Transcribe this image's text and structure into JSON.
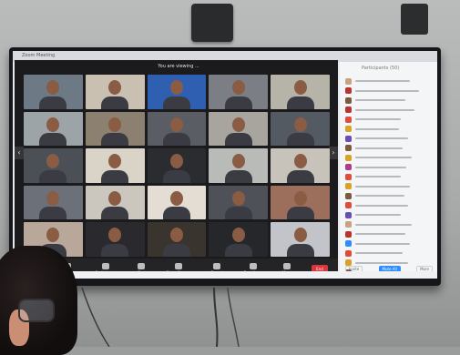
{
  "window": {
    "title": "Zoom Meeting"
  },
  "banner": "You are viewing ...",
  "nav": {
    "prev_icon": "chevron-left-icon",
    "next_icon": "chevron-right-icon"
  },
  "tiles": [
    {
      "name": "",
      "bg": "#6d7a86"
    },
    {
      "name": "",
      "bg": "#c9c0b2"
    },
    {
      "name": "",
      "bg": "#2f5fb0"
    },
    {
      "name": "",
      "bg": "#7b7f85"
    },
    {
      "name": "",
      "bg": "#b6b3a8"
    },
    {
      "name": "",
      "bg": "#9da4a8"
    },
    {
      "name": "",
      "bg": "#8c8170"
    },
    {
      "name": "",
      "bg": "#5a5d63"
    },
    {
      "name": "",
      "bg": "#a7a59d"
    },
    {
      "name": "",
      "bg": "#545a62"
    },
    {
      "name": "",
      "bg": "#4b4f56"
    },
    {
      "name": "",
      "bg": "#d9d3c8"
    },
    {
      "name": "",
      "bg": "#2b2c30"
    },
    {
      "name": "",
      "bg": "#b9bbb8"
    },
    {
      "name": "",
      "bg": "#c7c3bb"
    },
    {
      "name": "",
      "bg": "#6c7078"
    },
    {
      "name": "",
      "bg": "#cbc6be"
    },
    {
      "name": "",
      "bg": "#e3ddd4"
    },
    {
      "name": "",
      "bg": "#4e5158"
    },
    {
      "name": "",
      "bg": "#9b6f5c"
    },
    {
      "name": "",
      "bg": "#b9a89a"
    },
    {
      "name": "",
      "bg": "#2a2a2e"
    },
    {
      "name": "",
      "bg": "#3a342f"
    },
    {
      "name": "",
      "bg": "#26272a"
    },
    {
      "name": "",
      "bg": "#c2c4c9"
    }
  ],
  "toolbar": {
    "items": [
      {
        "label": "Unmute",
        "icon": "microphone-icon"
      },
      {
        "label": "Security",
        "icon": "shield-icon"
      },
      {
        "label": "Participants",
        "icon": "participants-icon"
      },
      {
        "label": "Chat",
        "icon": "chat-icon"
      },
      {
        "label": "Share Screen",
        "icon": "share-screen-icon"
      },
      {
        "label": "Record",
        "icon": "record-icon"
      },
      {
        "label": "Reactions",
        "icon": "reactions-icon"
      },
      {
        "label": "More",
        "icon": "more-icon"
      }
    ],
    "end_label": "End"
  },
  "participants_panel": {
    "header": "Participants (50)",
    "rows": [
      {
        "color": "#c9a27e",
        "w": 60
      },
      {
        "color": "#b8342f",
        "w": 70
      },
      {
        "color": "#7c5a3f",
        "w": 55
      },
      {
        "color": "#b8342f",
        "w": 65
      },
      {
        "color": "#e14b3b",
        "w": 50
      },
      {
        "color": "#d9a227",
        "w": 48
      },
      {
        "color": "#6a4fb3",
        "w": 58
      },
      {
        "color": "#7c5a3f",
        "w": 52
      },
      {
        "color": "#d9a227",
        "w": 62
      },
      {
        "color": "#b23a8b",
        "w": 56
      },
      {
        "color": "#e14b3b",
        "w": 50
      },
      {
        "color": "#d9a227",
        "w": 60
      },
      {
        "color": "#7c5a3f",
        "w": 54
      },
      {
        "color": "#e14b3b",
        "w": 58
      },
      {
        "color": "#6a4fb3",
        "w": 50
      },
      {
        "color": "#c9a27e",
        "w": 62
      },
      {
        "color": "#b8342f",
        "w": 55
      },
      {
        "color": "#2d8cff",
        "w": 60
      },
      {
        "color": "#e14b3b",
        "w": 52
      },
      {
        "color": "#d9a227",
        "w": 58
      },
      {
        "color": "#7c5a3f",
        "w": 50
      }
    ],
    "invite_label": "Invite",
    "mute_all_label": "Mute All",
    "more_label": "More"
  }
}
